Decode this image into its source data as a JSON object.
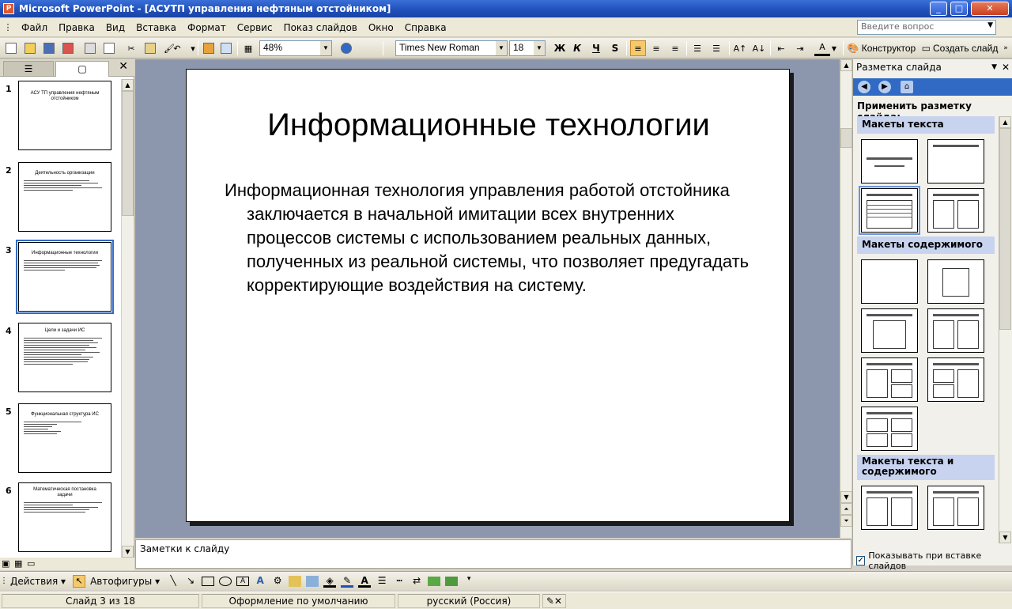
{
  "window": {
    "title": "Microsoft PowerPoint - [АСУТП управления нефтяным отстойником]",
    "app_icon": "P"
  },
  "menu": {
    "items": [
      "Файл",
      "Правка",
      "Вид",
      "Вставка",
      "Формат",
      "Сервис",
      "Показ слайдов",
      "Окно",
      "Справка"
    ],
    "help_placeholder": "Введите вопрос"
  },
  "toolbar": {
    "zoom": "48%",
    "font": "Times New Roman",
    "font_size": "18",
    "bold": "Ж",
    "italic": "К",
    "underline": "Ч",
    "shadow": "S",
    "designer": "Конструктор",
    "new_slide": "Создать слайд"
  },
  "outline": {
    "tab_outline_icon": "list-icon",
    "tab_slides_icon": "slide-icon",
    "slides": [
      {
        "num": "1",
        "title": "АСУ ТП управления нефтяным отстойником",
        "lines": 0
      },
      {
        "num": "2",
        "title": "Деятельность организации",
        "lines": 5
      },
      {
        "num": "3",
        "title": "Информационные технологии",
        "lines": 5
      },
      {
        "num": "4",
        "title": "Цели и задачи ИС",
        "lines": 12
      },
      {
        "num": "5",
        "title": "Функциональная структура ИС",
        "lines": 6
      },
      {
        "num": "6",
        "title": "Математическая постановка задачи",
        "lines": 5
      }
    ]
  },
  "slide": {
    "title": "Информационные технологии",
    "body": "Информационная технология управления работой отстойника заключается в начальной имитации всех внутренних процессов системы с использованием реальных данных, полученных из реальной системы, что позволяет предугадать корректирующие воздействия на систему."
  },
  "notes": {
    "placeholder": "Заметки к слайду"
  },
  "taskpane": {
    "title": "Разметка слайда",
    "apply_label": "Применить разметку слайда:",
    "section_text": "Макеты текста",
    "section_content": "Макеты содержимого",
    "section_text_content": "Макеты текста и содержимого",
    "show_on_insert": "Показывать при вставке слайдов"
  },
  "drawing": {
    "actions": "Действия",
    "autoshapes": "Автофигуры"
  },
  "status": {
    "slide": "Слайд 3 из 18",
    "design": "Оформление по умолчанию",
    "language": "русский (Россия)"
  },
  "colors": {
    "accent": "#316ac5",
    "titlebar": "#1f4fb8",
    "canvas": "#8c97ad"
  }
}
